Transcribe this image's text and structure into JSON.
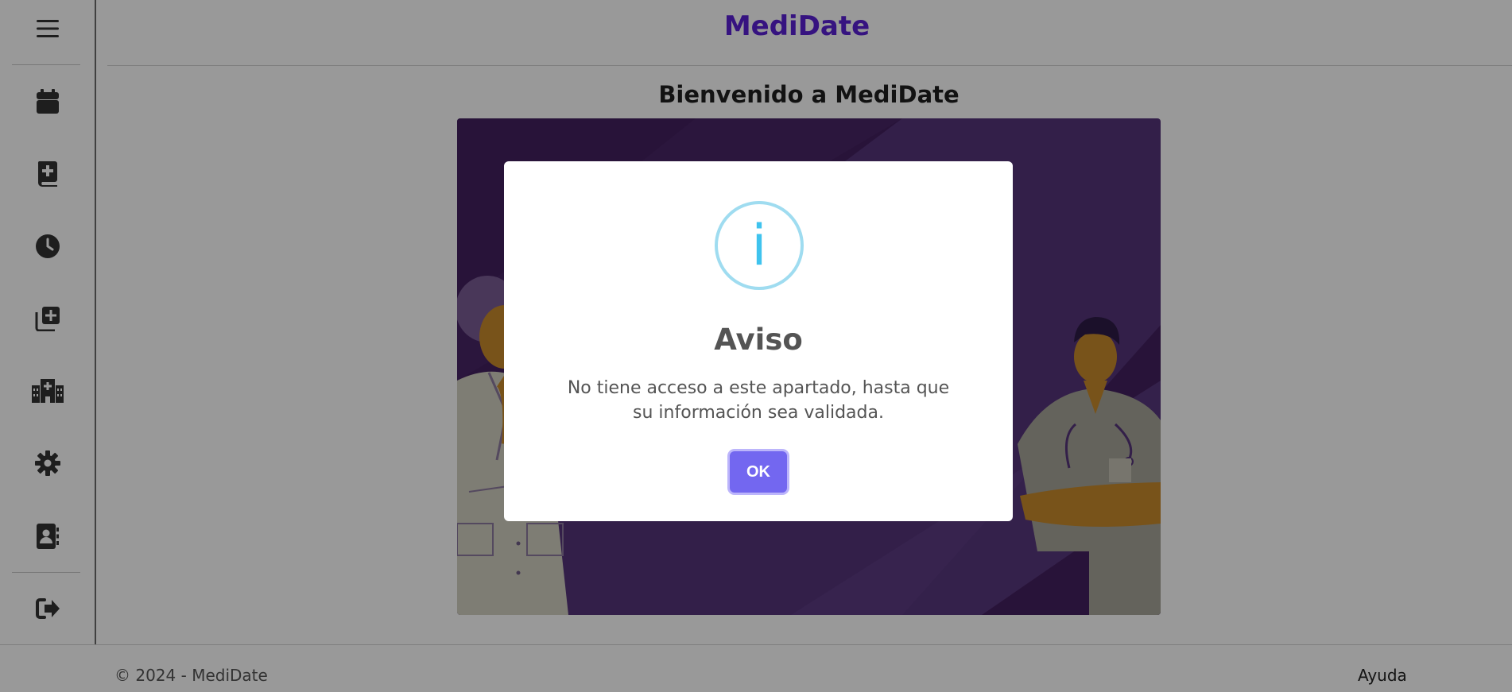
{
  "app": {
    "brand": "MediDate"
  },
  "sidebar": {
    "items": [
      {
        "icon": "hamburger-menu-icon"
      },
      {
        "icon": "calendar-icon"
      },
      {
        "icon": "medical-book-icon"
      },
      {
        "icon": "clock-icon"
      },
      {
        "icon": "add-copy-icon"
      },
      {
        "icon": "hospital-icon"
      },
      {
        "icon": "gear-icon"
      },
      {
        "icon": "contact-book-icon"
      },
      {
        "icon": "logout-icon"
      }
    ]
  },
  "main": {
    "welcome_title": "Bienvenido a MediDate",
    "banner_image": "doctors-illustration"
  },
  "footer": {
    "copyright": "© 2024 - MediDate",
    "help": "Ayuda"
  },
  "modal": {
    "icon": "info-icon",
    "icon_glyph": "i",
    "title": "Aviso",
    "message": "No tiene acceso a este apartado, hasta que su información sea validada.",
    "ok_label": "OK"
  },
  "colors": {
    "brand": "#5b21d6",
    "accent_button": "#7367f0",
    "info": "#3fc3ee",
    "banner": "#55357a"
  }
}
